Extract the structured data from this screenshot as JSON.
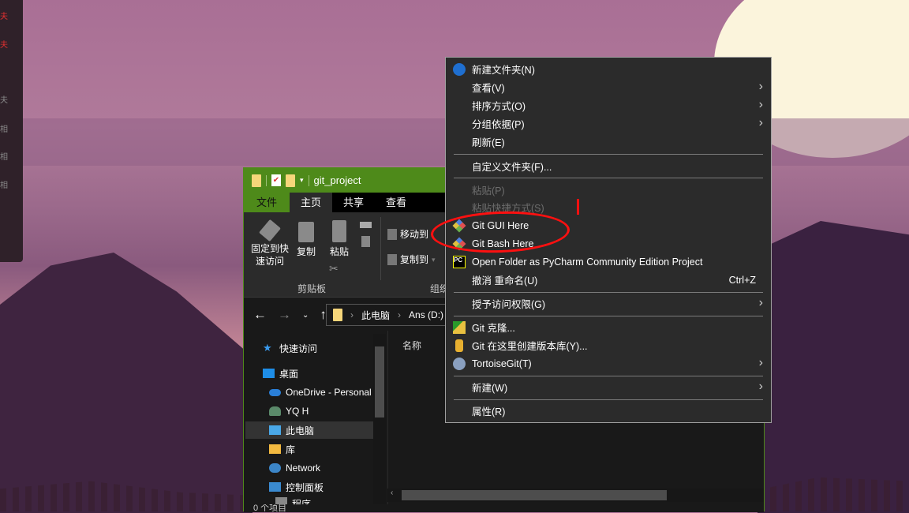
{
  "colors": {
    "accent_green": "#4e8a1a",
    "menu_bg": "#2b2b2b",
    "annotation_red": "#ff1010"
  },
  "explorer": {
    "title": "git_project",
    "tabs": [
      {
        "label": "文件"
      },
      {
        "label": "主页"
      },
      {
        "label": "共享"
      },
      {
        "label": "查看"
      }
    ],
    "ribbon": {
      "pin_label": "固定到快\n速访问",
      "copy_label": "复制",
      "paste_label": "粘贴",
      "move_to": "移动到",
      "copy_to": "复制到",
      "group_clipboard": "剪贴板",
      "group_organize": "组织"
    },
    "address": {
      "segments": [
        "此电脑",
        "Ans (D:)"
      ]
    },
    "nav": [
      {
        "label": "快速访问",
        "icon": "star-icon"
      },
      {
        "label": "桌面",
        "icon": "desktop-icon"
      },
      {
        "label": "OneDrive - Personal",
        "icon": "cloud-icon"
      },
      {
        "label": "YQ H",
        "icon": "user-icon"
      },
      {
        "label": "此电脑",
        "icon": "computer-icon",
        "selected": true
      },
      {
        "label": "库",
        "icon": "library-icon"
      },
      {
        "label": "Network",
        "icon": "network-icon"
      },
      {
        "label": "控制面板",
        "icon": "control-panel-icon"
      },
      {
        "label": "程序",
        "icon": "program-icon"
      }
    ],
    "column_name": "名称",
    "status": "0 个项目"
  },
  "context_menu": {
    "items": [
      {
        "label": "新建文件夹(N)",
        "icon": "new-folder-icon"
      },
      {
        "label": "查看(V)",
        "submenu": true
      },
      {
        "label": "排序方式(O)",
        "submenu": true
      },
      {
        "label": "分组依据(P)",
        "submenu": true
      },
      {
        "label": "刷新(E)"
      },
      {
        "label": "自定义文件夹(F)..."
      },
      {
        "label": "粘贴(P)",
        "disabled": true
      },
      {
        "label": "粘贴快捷方式(S)",
        "disabled": true
      },
      {
        "label": "Git GUI Here",
        "icon": "git-gui-icon"
      },
      {
        "label": "Git Bash Here",
        "icon": "git-bash-icon"
      },
      {
        "label": "Open Folder as PyCharm Community Edition Project",
        "icon": "pycharm-icon"
      },
      {
        "label": "撤消 重命名(U)",
        "shortcut": "Ctrl+Z"
      },
      {
        "label": "授予访问权限(G)",
        "submenu": true
      },
      {
        "label": "Git 克隆...",
        "icon": "git-clone-icon"
      },
      {
        "label": "Git 在这里创建版本库(Y)...",
        "icon": "git-create-repo-icon"
      },
      {
        "label": "TortoiseGit(T)",
        "icon": "tortoisegit-icon",
        "submenu": true
      },
      {
        "label": "新建(W)",
        "submenu": true
      },
      {
        "label": "属性(R)"
      }
    ]
  }
}
